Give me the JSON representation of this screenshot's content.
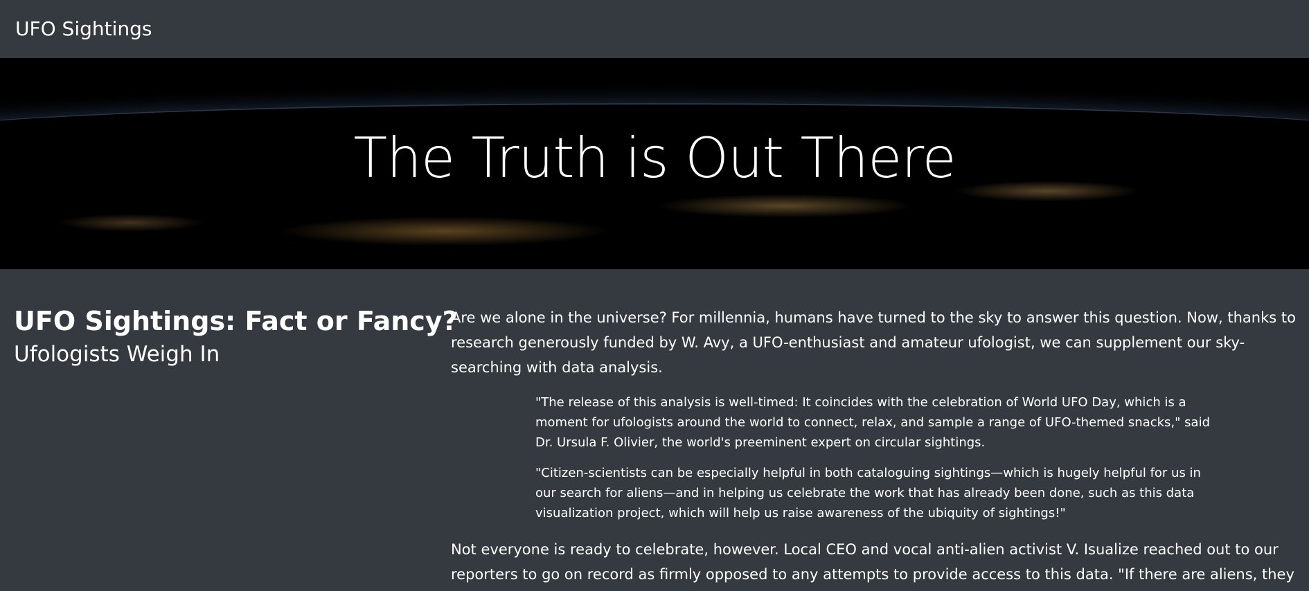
{
  "navbar": {
    "brand": "UFO Sightings"
  },
  "hero": {
    "title": "The Truth is Out There"
  },
  "sidebar": {
    "headline": "UFO Sightings: Fact or Fancy?",
    "subheadline": "Ufologists Weigh In"
  },
  "article": {
    "intro": "Are we alone in the universe? For millennia, humans have turned to the sky to answer this question. Now, thanks to research generously funded by W. Avy, a UFO-enthusiast and amateur ufologist, we can supplement our sky-searching with data analysis.",
    "quotes": [
      "\"The release of this analysis is well-timed: It coincides with the celebration of World UFO Day, which is a moment for ufologists around the world to connect, relax, and sample a range of UFO-themed snacks,\" said Dr. Ursula F. Olivier, the world's preeminent expert on circular sightings.",
      "\"Citizen-scientists can be especially helpful in both cataloguing sightings—which is hugely helpful for us in our search for aliens—and in helping us celebrate the work that has already been done, such as this data visualization project, which will help us raise awareness of the ubiquity of sightings!\""
    ],
    "closing": "Not everyone is ready to celebrate, however. Local CEO and vocal anti-alien activist V. Isualize reached out to our reporters to go on record as firmly opposed to any attempts to provide access to this data. \"If there are aliens, they"
  }
}
